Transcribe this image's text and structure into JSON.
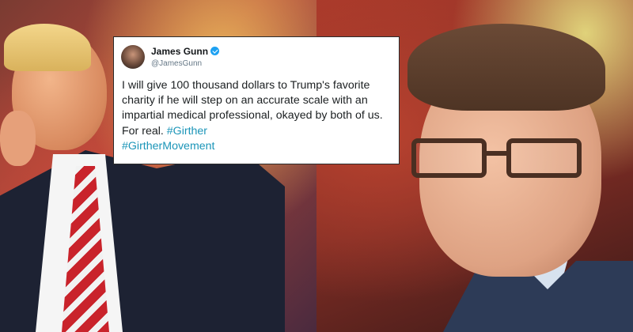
{
  "tweet": {
    "author_name": "James Gunn",
    "author_handle": "@JamesGunn",
    "text": "I will give 100 thousand dollars to Trump's favorite charity if he will step on an accurate scale with an impartial medical professional, okayed by both of us. For real.",
    "hashtags": [
      "#Girther",
      "#GirtherMovement"
    ],
    "link_color": "#1b95b8",
    "verified_badge_color": "#1da1f2"
  },
  "icons": {
    "verified": "verified-badge-icon",
    "avatar": "profile-avatar"
  }
}
